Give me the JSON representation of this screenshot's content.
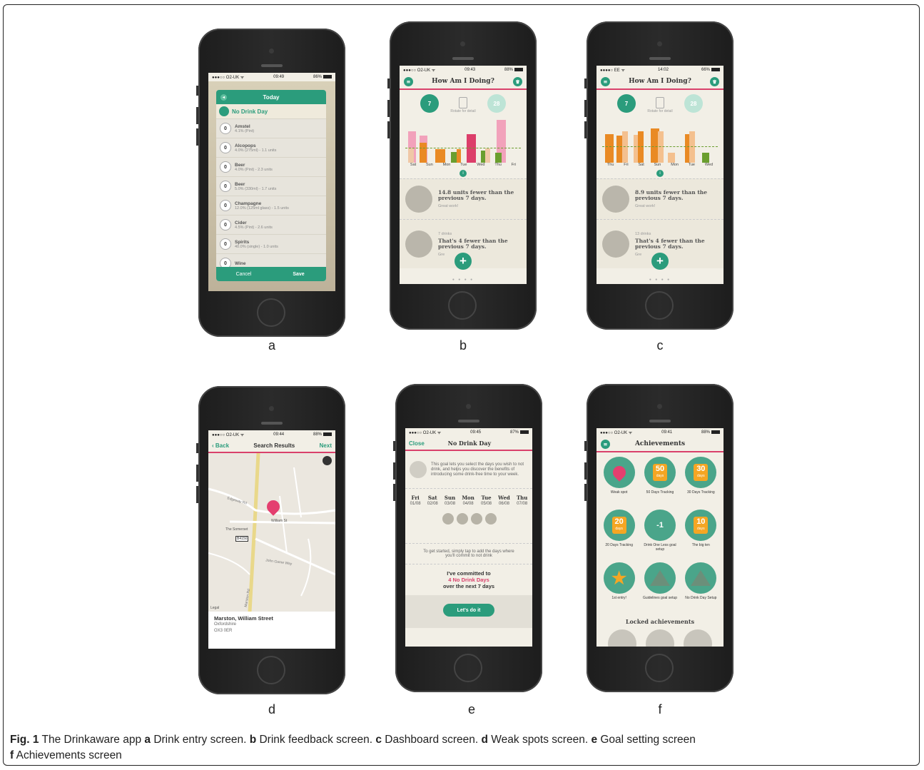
{
  "panel_labels": [
    "a",
    "b",
    "c",
    "d",
    "e",
    "f"
  ],
  "caption": {
    "fig": "Fig. 1",
    "text_intro": " The Drinkaware app ",
    "parts": [
      {
        "letter": "a",
        "desc": " Drink entry screen. "
      },
      {
        "letter": "b",
        "desc": " Drink feedback screen. "
      },
      {
        "letter": "c",
        "desc": " Dashboard screen. "
      },
      {
        "letter": "d",
        "desc": " Weak spots screen. "
      },
      {
        "letter": "e",
        "desc": " Goal setting screen"
      },
      {
        "letter": "f",
        "desc": " Achievements screen"
      }
    ]
  },
  "screen_a": {
    "status": {
      "carrier": "●●●○○ O2-UK ᯤ",
      "time": "09:49",
      "battery": "86%"
    },
    "title": "Today",
    "no_drink": "No Drink Day",
    "drinks": [
      {
        "count": "0",
        "name": "Amstel",
        "detail": "4.1% (Pint)"
      },
      {
        "count": "0",
        "name": "Alcopops",
        "detail": "4.0% (275ml) - 1.1 units"
      },
      {
        "count": "0",
        "name": "Beer",
        "detail": "4.0% (Pint) - 2.3 units"
      },
      {
        "count": "0",
        "name": "Beer",
        "detail": "5.0% (330ml) - 1.7 units"
      },
      {
        "count": "0",
        "name": "Champagne",
        "detail": "12.0% (125ml glass) - 1.5 units"
      },
      {
        "count": "0",
        "name": "Cider",
        "detail": "4.5% (Pint) - 2.6 units"
      },
      {
        "count": "0",
        "name": "Spirits",
        "detail": "40.0% (single) - 1.0 units"
      },
      {
        "count": "0",
        "name": "Wine",
        "detail": ""
      }
    ],
    "cancel": "Cancel",
    "save": "Save"
  },
  "screen_b": {
    "status": {
      "carrier": "●●●○○ O2-UK ᯤ",
      "time": "09:43",
      "battery": "88%"
    },
    "title": "How Am I Doing?",
    "cal_left": "7",
    "cal_right": "28",
    "rotate": "Rotate for detail",
    "days": [
      "Sat",
      "Sun",
      "Mon",
      "Tue",
      "Wed",
      "Thu",
      "Fri"
    ],
    "card1_title": "14.8 units fewer than the previous 7 days.",
    "card1_sub": "Great work!",
    "card2_top": "7 drinks",
    "card2_title": "That's 4 fewer than the previous 7 days.",
    "card2_sub": "Gre"
  },
  "screen_c": {
    "status": {
      "carrier": "●●●●○ EE ᯤ",
      "time": "14:02",
      "battery": "66%"
    },
    "title": "How Am I Doing?",
    "cal_left": "7",
    "cal_right": "28",
    "rotate": "Rotate for detail",
    "days": [
      "Thu",
      "Fri",
      "Sat",
      "Sun",
      "Mon",
      "Tue",
      "Wed"
    ],
    "card1_title": "8.9 units fewer than the previous 7 days.",
    "card1_sub": "Great work!",
    "card2_top": "13 drinks",
    "card2_title": "That's 4 fewer than the previous 7 days.",
    "card2_sub": "Gre"
  },
  "screen_d": {
    "status": {
      "carrier": "●●●○○ O2-UK ᯤ",
      "time": "09:44",
      "battery": "88%"
    },
    "back": "Back",
    "title": "Search Results",
    "next": "Next",
    "map_labels": {
      "road1": "B4150",
      "pub": "The Somerset",
      "street": "William St",
      "road2": "Edgeway Rd",
      "road3": "John Garne Way",
      "road4": "Marston Rd"
    },
    "addr_name": "Marston, William Street",
    "addr_county": "Oxfordshire",
    "addr_post": "OX3 0ER",
    "legal": "Legal"
  },
  "screen_e": {
    "status": {
      "carrier": "●●●○○ O2-UK ᯤ",
      "time": "09:45",
      "battery": "87%"
    },
    "close": "Close",
    "title": "No Drink Day",
    "intro": "This goal lets you select the days you wish to not drink, and helps you discover the benefits of introducing some drink-free time to your week.",
    "week": [
      {
        "d": "Fri",
        "date": "01/08"
      },
      {
        "d": "Sat",
        "date": "02/08"
      },
      {
        "d": "Sun",
        "date": "03/08"
      },
      {
        "d": "Mon",
        "date": "04/08"
      },
      {
        "d": "Tue",
        "date": "05/08"
      },
      {
        "d": "Wed",
        "date": "06/08"
      },
      {
        "d": "Thu",
        "date": "07/08"
      }
    ],
    "tap": "To get started, simply tap to add the days where you'll commit to not drink",
    "commit_1": "I've committed to",
    "commit_2": "4 No Drink Days",
    "commit_3": "over the next 7 days",
    "cta": "Let's do it"
  },
  "screen_f": {
    "status": {
      "carrier": "●●●○○ O2-UK ᯤ",
      "time": "09:41",
      "battery": "88%"
    },
    "title": "Achievements",
    "badges": [
      {
        "label": "Weak spot",
        "value": ""
      },
      {
        "label": "50 Days Tracking",
        "value": "50"
      },
      {
        "label": "30 Days Tracking",
        "value": "30"
      },
      {
        "label": "20 Days Tracking",
        "value": "20"
      },
      {
        "label": "Drink One Less goal setup",
        "value": "-1"
      },
      {
        "label": "The big ten",
        "value": "10"
      },
      {
        "label": "1st entry!",
        "value": ""
      },
      {
        "label": "Guidelines goal setup",
        "value": ""
      },
      {
        "label": "No Drink Day Setup",
        "value": ""
      }
    ],
    "days_word": "days",
    "locked": "Locked achievements"
  }
}
